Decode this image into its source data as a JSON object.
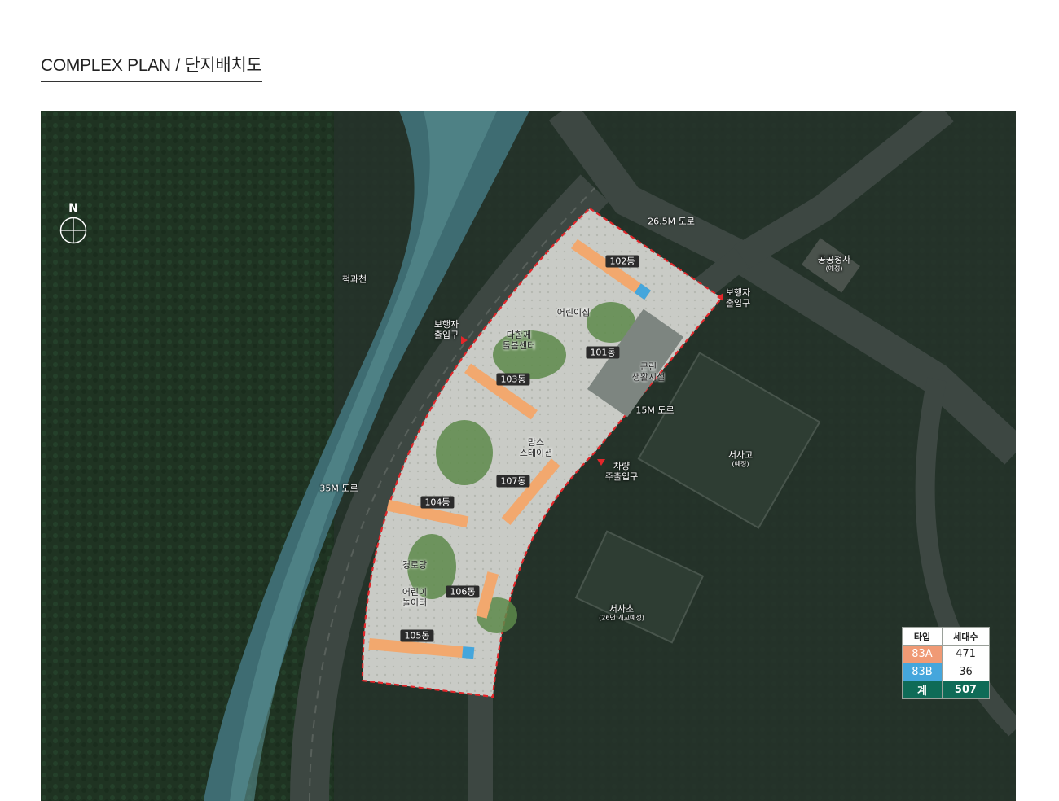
{
  "page": {
    "title": "COMPLEX PLAN / 단지배치도"
  },
  "compass": {
    "label": "N"
  },
  "map_labels": {
    "stream": "척과천",
    "road_35m": "35M 도로",
    "road_26_5m": "26.5M 도로",
    "road_15m": "15M 도로",
    "public_office": {
      "name": "공공청사",
      "note": "(예정)"
    },
    "high_school": {
      "name": "서사고",
      "note": "(예정)"
    },
    "elementary_school": {
      "name": "서사초",
      "note": "(26년 개교예정)"
    },
    "daycare": "어린이집",
    "care_center": {
      "line1": "다함께",
      "line2": "돌봄센터"
    },
    "commercial": {
      "line1": "근린",
      "line2": "생활시설"
    },
    "moms_station": {
      "line1": "맘스",
      "line2": "스테이션"
    },
    "senior_center": "경로당",
    "playground": {
      "line1": "어린이",
      "line2": "놀이터"
    }
  },
  "entrances": {
    "pedestrian_west": {
      "line1": "보행자",
      "line2": "출입구"
    },
    "pedestrian_east": {
      "line1": "보행자",
      "line2": "출입구"
    },
    "vehicle": {
      "line1": "차량",
      "line2": "주출입구"
    }
  },
  "buildings": {
    "b101": "101동",
    "b102": "102동",
    "b103": "103동",
    "b104": "104동",
    "b105": "105동",
    "b106": "106동",
    "b107": "107동"
  },
  "type_table": {
    "headers": [
      "타입",
      "세대수"
    ],
    "rows": [
      {
        "type": "83A",
        "count": "471"
      },
      {
        "type": "83B",
        "count": "36"
      }
    ],
    "total": {
      "label": "계",
      "count": "507"
    }
  },
  "colors": {
    "type_83a": "#f09a75",
    "type_83b": "#45a6dc",
    "total": "#0f6b57",
    "boundary": "#e3262a"
  }
}
